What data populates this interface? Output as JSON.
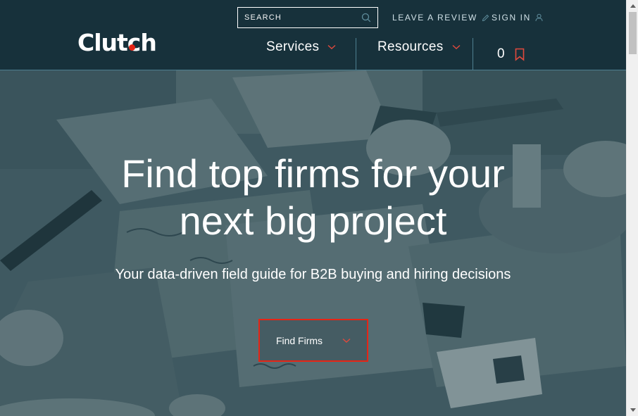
{
  "header": {
    "logo_text": "Clutch",
    "search": {
      "placeholder": "SEARCH"
    },
    "leave_review_label": "LEAVE A REVIEW",
    "sign_in_label": "SIGN IN",
    "nav": {
      "services_label": "Services",
      "resources_label": "Resources",
      "saved_count": "0"
    }
  },
  "hero": {
    "title_line1": "Find top firms for your",
    "title_line2": "next big project",
    "subtitle": "Your data-driven field guide for B2B buying and hiring decisions",
    "cta_label": "Find Firms"
  },
  "colors": {
    "header_bg": "#17313b",
    "accent_red": "#e62415",
    "nav_divider": "#4e7f90",
    "hero_overlay": "#2a4650"
  },
  "icons": {
    "search": "search-icon",
    "review": "pencil-icon",
    "sign_in": "user-icon",
    "dropdown": "chevron-down-icon",
    "saved": "bookmark-icon"
  }
}
